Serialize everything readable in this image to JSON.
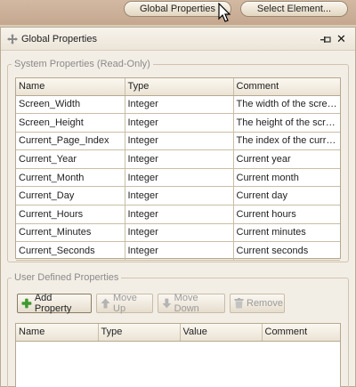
{
  "toolbar": {
    "global_properties": "Global Properties",
    "select_element": "Select Element..."
  },
  "panel": {
    "title": "Global Properties"
  },
  "system": {
    "legend": "System Properties (Read-Only)",
    "columns": [
      "Name",
      "Type",
      "Comment"
    ],
    "rows": [
      [
        "Screen_Width",
        "Integer",
        "The width of the screen."
      ],
      [
        "Screen_Height",
        "Integer",
        "The height of the screen."
      ],
      [
        "Current_Page_Index",
        "Integer",
        "The index of the current page."
      ],
      [
        "Current_Year",
        "Integer",
        "Current year"
      ],
      [
        "Current_Month",
        "Integer",
        "Current month"
      ],
      [
        "Current_Day",
        "Integer",
        "Current day"
      ],
      [
        "Current_Hours",
        "Integer",
        "Current hours"
      ],
      [
        "Current_Minutes",
        "Integer",
        "Current minutes"
      ],
      [
        "Current_Seconds",
        "Integer",
        "Current seconds"
      ]
    ]
  },
  "user": {
    "legend": "User Defined Properties",
    "buttons": {
      "add": "Add Property",
      "move_up": "Move Up",
      "move_down": "Move Down",
      "remove": "Remove"
    },
    "columns": [
      "Name",
      "Type",
      "Value",
      "Comment"
    ]
  },
  "colors": {
    "accent_green": "#3d9a2e",
    "toolbar_bg": "#c9ad95"
  }
}
